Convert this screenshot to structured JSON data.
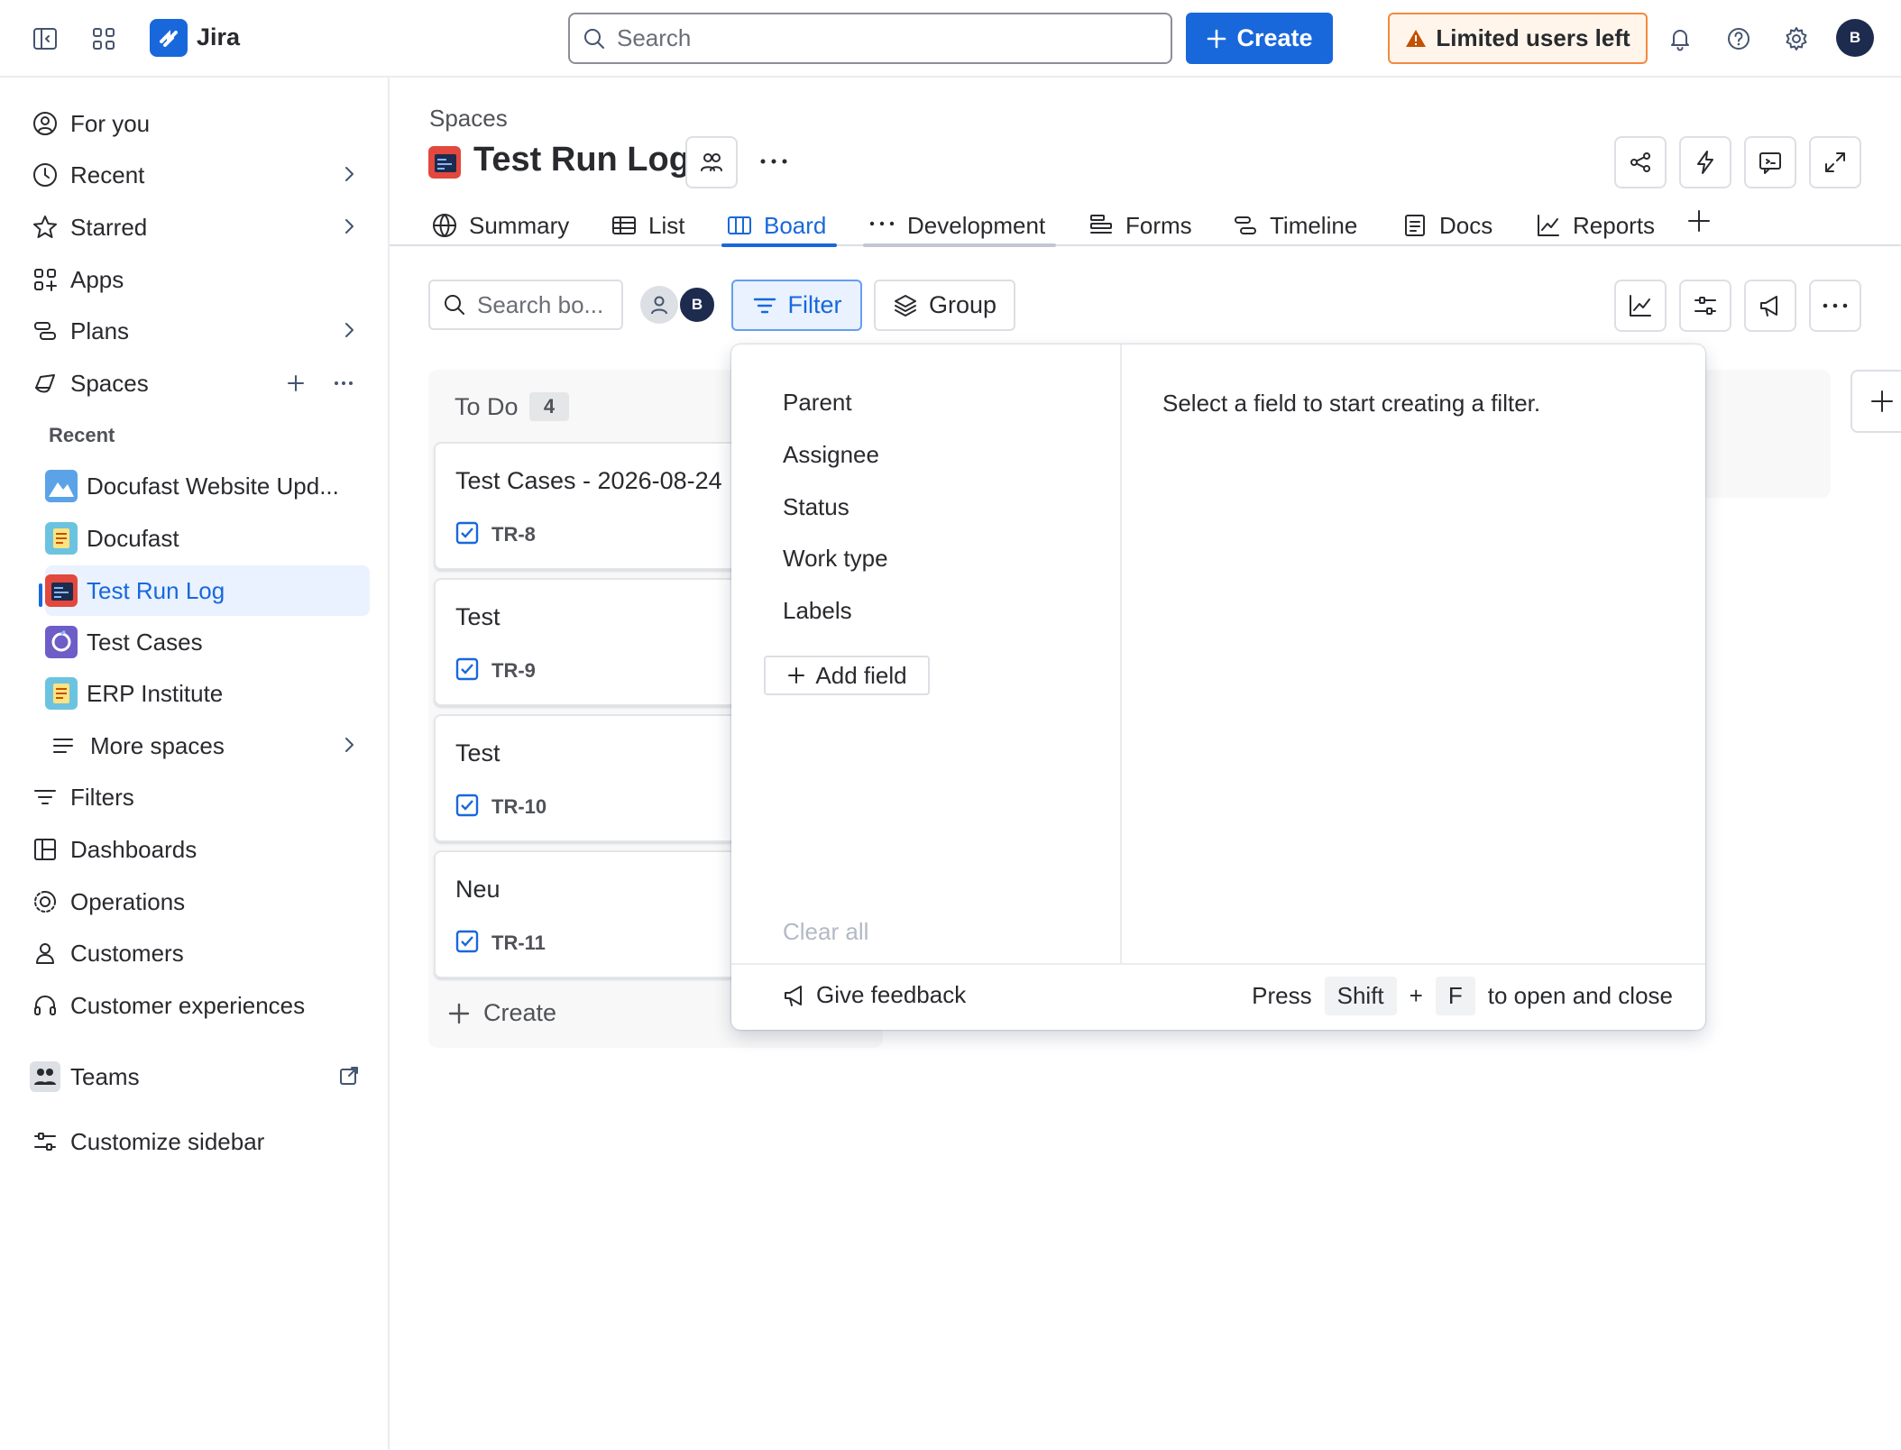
{
  "topbar": {
    "app_name": "Jira",
    "search_placeholder": "Search",
    "create_label": "Create",
    "limited_label": "Limited users left",
    "avatar_initial": "B"
  },
  "sidebar": {
    "items": [
      {
        "label": "For you",
        "icon": "user-circle-icon"
      },
      {
        "label": "Recent",
        "icon": "clock-icon"
      },
      {
        "label": "Starred",
        "icon": "star-icon"
      },
      {
        "label": "Apps",
        "icon": "apps-icon"
      },
      {
        "label": "Plans",
        "icon": "plans-icon"
      },
      {
        "label": "Spaces",
        "icon": "spaces-icon"
      }
    ],
    "recent_heading": "Recent",
    "spaces": [
      {
        "label": "Docufast Website Upd...",
        "color": "#6CC3E0"
      },
      {
        "label": "Docufast",
        "color": "#6CC3E0"
      },
      {
        "label": "Test Run Log",
        "color": "#E2483D"
      },
      {
        "label": "Test Cases",
        "color": "#6E5DC6"
      },
      {
        "label": "ERP Institute",
        "color": "#6CC3E0"
      }
    ],
    "more_spaces": "More spaces",
    "bottom_items": [
      {
        "label": "Filters",
        "icon": "filter-icon"
      },
      {
        "label": "Dashboards",
        "icon": "dashboard-icon"
      },
      {
        "label": "Operations",
        "icon": "operations-icon"
      },
      {
        "label": "Customers",
        "icon": "person-icon"
      },
      {
        "label": "Customer experiences",
        "icon": "headset-icon"
      }
    ],
    "teams": "Teams",
    "customize": "Customize sidebar"
  },
  "header": {
    "breadcrumb": "Spaces",
    "title": "Test Run Log"
  },
  "tabs": [
    {
      "label": "Summary",
      "icon": "globe-icon"
    },
    {
      "label": "List",
      "icon": "list-icon"
    },
    {
      "label": "Board",
      "icon": "board-icon",
      "active": true
    },
    {
      "label": "Development",
      "icon": "more-icon"
    },
    {
      "label": "Forms",
      "icon": "forms-icon"
    },
    {
      "label": "Timeline",
      "icon": "timeline-icon"
    },
    {
      "label": "Docs",
      "icon": "docs-icon"
    },
    {
      "label": "Reports",
      "icon": "reports-icon"
    }
  ],
  "toolbar": {
    "board_search_placeholder": "Search bo...",
    "avatar_initial": "B",
    "filter_label": "Filter",
    "group_label": "Group"
  },
  "board": {
    "column_title": "To Do",
    "column_count": "4",
    "cards": [
      {
        "title": "Test Cases - 2026-08-24",
        "key": "TR-8"
      },
      {
        "title": "Test",
        "key": "TR-9"
      },
      {
        "title": "Test",
        "key": "TR-10"
      },
      {
        "title": "Neu",
        "key": "TR-11"
      }
    ],
    "create_label": "Create"
  },
  "filter_popup": {
    "fields": [
      "Parent",
      "Assignee",
      "Status",
      "Work type",
      "Labels"
    ],
    "add_field": "Add field",
    "clear_all": "Clear all",
    "hint": "Select a field to start creating a filter.",
    "feedback": "Give feedback",
    "press": "Press",
    "key_shift": "Shift",
    "plus": "+",
    "key_f": "F",
    "shortcut_suffix": "to open and close"
  },
  "colors": {
    "brand": "#1868DB",
    "selected_bg": "#E9F2FE",
    "warning": "#C25100"
  }
}
